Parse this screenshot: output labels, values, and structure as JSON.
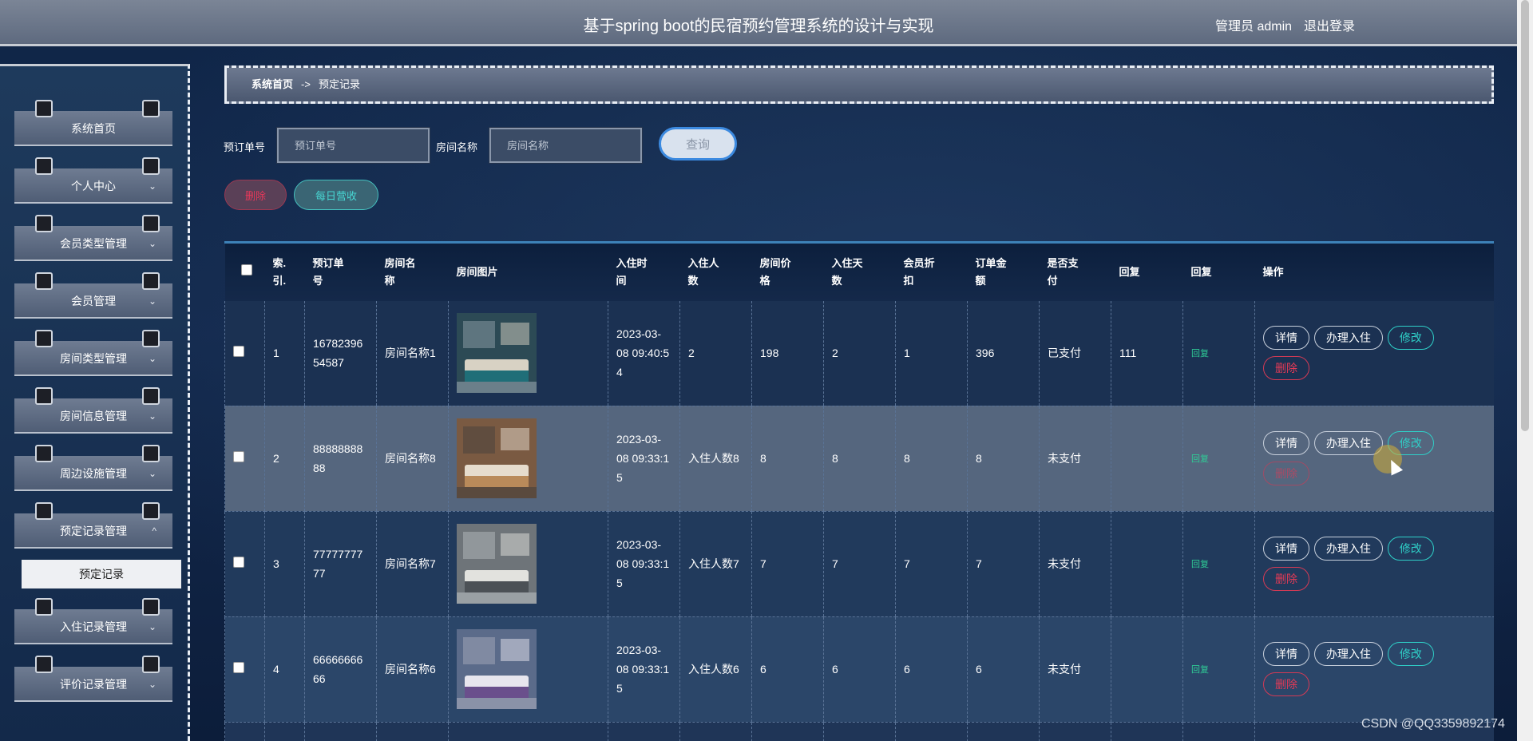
{
  "header": {
    "title": "基于spring boot的民宿预约管理系统的设计与实现",
    "user": "管理员 admin",
    "logout": "退出登录"
  },
  "sidebar": {
    "items": [
      {
        "label": "系统首页",
        "expandable": false
      },
      {
        "label": "个人中心",
        "expandable": true
      },
      {
        "label": "会员类型管理",
        "expandable": true
      },
      {
        "label": "会员管理",
        "expandable": true
      },
      {
        "label": "房间类型管理",
        "expandable": true
      },
      {
        "label": "房间信息管理",
        "expandable": true
      },
      {
        "label": "周边设施管理",
        "expandable": true
      },
      {
        "label": "预定记录管理",
        "expandable": true,
        "expanded": true
      },
      {
        "label": "入住记录管理",
        "expandable": true
      },
      {
        "label": "评价记录管理",
        "expandable": true
      }
    ],
    "subitem": "预定记录",
    "chev_down": "⌄",
    "chev_up": "^"
  },
  "breadcrumb": {
    "home": "系统首页",
    "sep": "->",
    "current": "预定记录"
  },
  "search": {
    "order_label": "预订单号",
    "order_placeholder": "预订单号",
    "room_label": "房间名称",
    "room_placeholder": "房间名称",
    "query": "查询"
  },
  "actions": {
    "delete": "删除",
    "daily_income": "每日营收"
  },
  "table": {
    "headers": [
      "索引",
      "预订单号",
      "房间名称",
      "房间图片",
      "入住时间",
      "入住人数",
      "房间价格",
      "入住天数",
      "会员折扣",
      "订单金额",
      "是否支付",
      "回复",
      "回复",
      "操作"
    ],
    "header_lines": [
      [
        "索.",
        "引."
      ],
      [
        "预订单",
        "号"
      ],
      [
        "房间名",
        "称"
      ],
      [
        "房间图片"
      ],
      [
        "入住时",
        "间"
      ],
      [
        "入住人",
        "数"
      ],
      [
        "房间价",
        "格"
      ],
      [
        "入住天",
        "数"
      ],
      [
        "会员折",
        "扣"
      ],
      [
        "订单金",
        "额"
      ],
      [
        "是否支",
        "付"
      ],
      [
        "回复"
      ],
      [
        "回复"
      ],
      [
        "操作"
      ]
    ],
    "rows": [
      {
        "index": "1",
        "order_lines": [
          "16782396",
          "54587"
        ],
        "room": "房间名称1",
        "time_lines": [
          "2023-03-",
          "08 09:40:5",
          "4"
        ],
        "people": "2",
        "price": "198",
        "days": "2",
        "discount": "1",
        "amount": "396",
        "paid": "已支付",
        "reply": "111",
        "reply_link": "回复",
        "img": "teal"
      },
      {
        "index": "2",
        "order_lines": [
          "88888888",
          "88"
        ],
        "room": "房间名称8",
        "time_lines": [
          "2023-03-",
          "08 09:33:1",
          "5"
        ],
        "people": "入住人数8",
        "price": "8",
        "days": "8",
        "discount": "8",
        "amount": "8",
        "paid": "未支付",
        "reply": "",
        "reply_link": "回复",
        "img": "warm"
      },
      {
        "index": "3",
        "order_lines": [
          "77777777",
          "77"
        ],
        "room": "房间名称7",
        "time_lines": [
          "2023-03-",
          "08 09:33:1",
          "5"
        ],
        "people": "入住人数7",
        "price": "7",
        "days": "7",
        "discount": "7",
        "amount": "7",
        "paid": "未支付",
        "reply": "",
        "reply_link": "回复",
        "img": "grey"
      },
      {
        "index": "4",
        "order_lines": [
          "66666666",
          "66"
        ],
        "room": "房间名称6",
        "time_lines": [
          "2023-03-",
          "08 09:33:1",
          "5"
        ],
        "people": "入住人数6",
        "price": "6",
        "days": "6",
        "discount": "6",
        "amount": "6",
        "paid": "未支付",
        "reply": "",
        "reply_link": "回复",
        "img": "purple"
      }
    ],
    "op_buttons": {
      "detail": "详情",
      "checkin": "办理入住",
      "edit": "修改",
      "delete": "删除"
    }
  },
  "watermark": "CSDN @QQ3359892174"
}
